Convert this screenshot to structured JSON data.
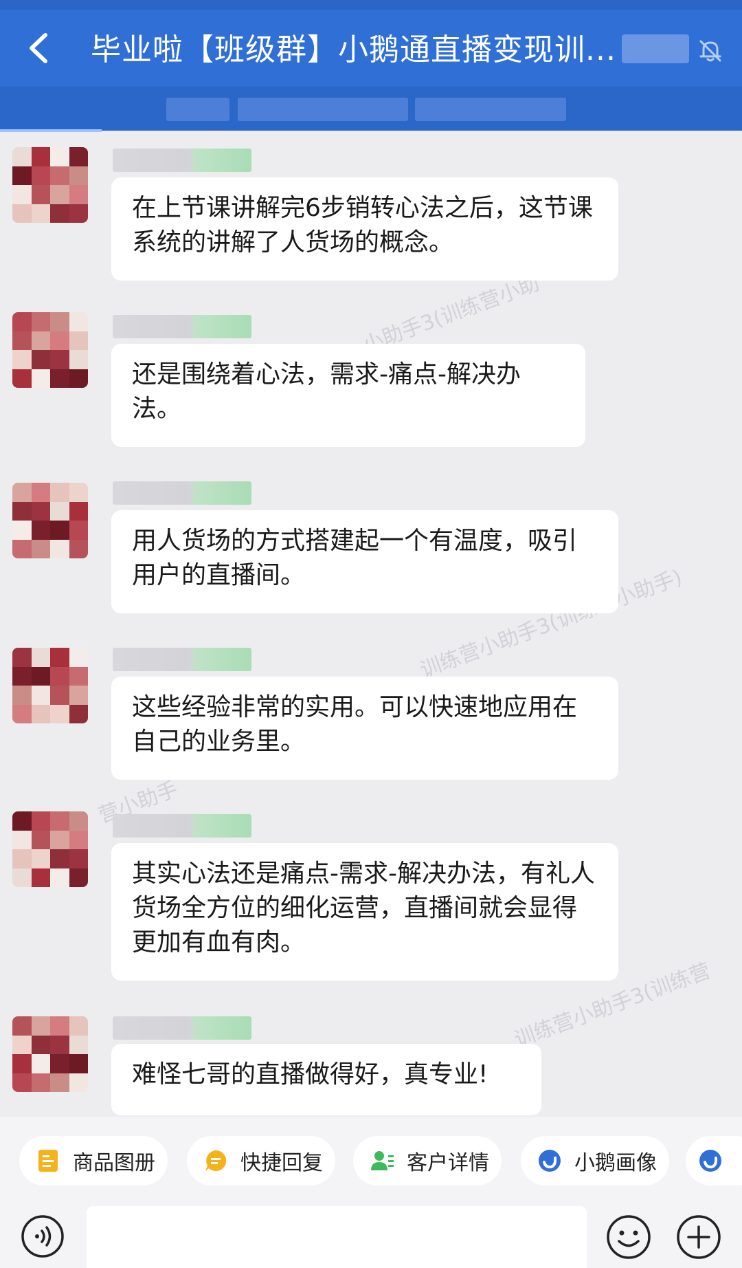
{
  "header": {
    "title": "毕业啦【班级群】小鹅通直播变现训...",
    "back_icon": "chevron-left-icon",
    "mute_icon": "bell-off-icon"
  },
  "messages": [
    {
      "text": "在上节课讲解完6步销转心法之后，这节课系统的讲解了人货场的概念。"
    },
    {
      "text": "还是围绕着心法，需求-痛点-解决办法。"
    },
    {
      "text": "用人货场的方式搭建起一个有温度，吸引用户的直播间。"
    },
    {
      "text": "这些经验非常的实用。可以快速地应用在自己的业务里。"
    },
    {
      "text": "其实心法还是痛点-需求-解决办法，有礼人货场全方位的细化运营，直播间就会显得更加有血有肉。"
    },
    {
      "text": "难怪七哥的直播做得好，真专业!"
    }
  ],
  "watermarks": [
    "小助手3(训练营小助",
    "训练营小助手3(训练营小助手)",
    "营小助手",
    "训练营小助手3(训练营"
  ],
  "quick_actions": [
    {
      "label": "商品图册",
      "icon": "product-album-icon",
      "color": "#f5b31b"
    },
    {
      "label": "快捷回复",
      "icon": "quick-reply-icon",
      "color": "#f5b31b"
    },
    {
      "label": "客户详情",
      "icon": "customer-detail-icon",
      "color": "#3dbb5c"
    },
    {
      "label": "小鹅画像",
      "icon": "xiaoe-portrait-icon",
      "color": "#2f6fd6"
    }
  ],
  "input": {
    "voice_icon": "voice-icon",
    "emoji_icon": "emoji-icon",
    "plus_icon": "plus-icon"
  },
  "colors": {
    "header_bg": "#2f6fd6",
    "chat_bg": "#ededf0",
    "bubble_bg": "#ffffff"
  }
}
